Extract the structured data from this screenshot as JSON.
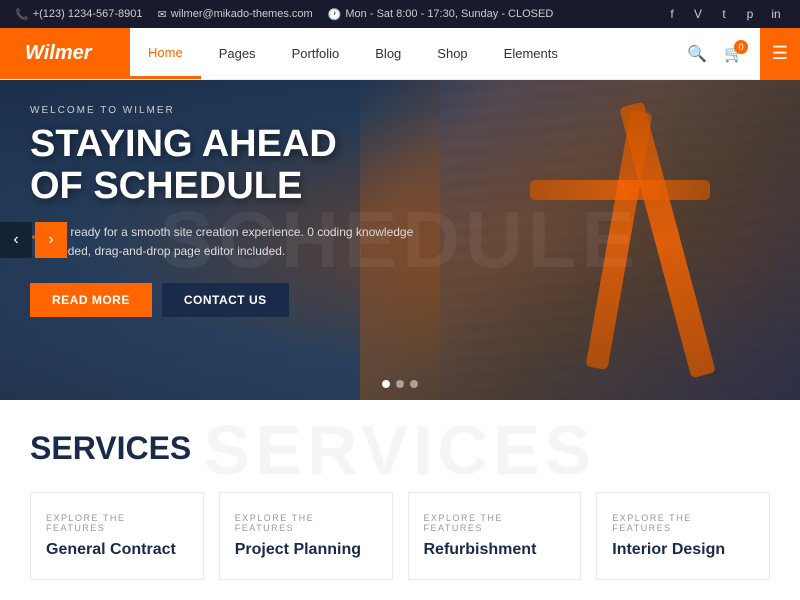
{
  "topbar": {
    "phone": "+(123) 1234-567-8901",
    "email": "wilmer@mikado-themes.com",
    "hours": "Mon - Sat 8:00 - 17:30, Sunday - CLOSED",
    "socials": [
      "f",
      "V",
      "t",
      "p",
      "in"
    ]
  },
  "navbar": {
    "logo": "Wilmer",
    "links": [
      {
        "label": "Home",
        "active": true
      },
      {
        "label": "Pages",
        "active": false
      },
      {
        "label": "Portfolio",
        "active": false
      },
      {
        "label": "Blog",
        "active": false
      },
      {
        "label": "Shop",
        "active": false
      },
      {
        "label": "Elements",
        "active": false
      }
    ],
    "cart_count": "0"
  },
  "hero": {
    "bg_text": "SCHEDULE",
    "welcome": "WELCOME TO WILMER",
    "title_line1": "STAYING AHEAD",
    "title_line2": "OF SCHEDULE",
    "subtitle": "Get ready for a smooth site creation experience. 0 coding knowledge needed, drag-and-drop page editor included.",
    "btn_primary": "Read More",
    "btn_secondary": "Contact Us",
    "dots": [
      {
        "active": true
      },
      {
        "active": false
      },
      {
        "active": false
      }
    ]
  },
  "services": {
    "bg_text": "SERVICES",
    "title": "SERVICES",
    "cards": [
      {
        "explore": "EXPLORE THE FEATURES",
        "name": "General Contract"
      },
      {
        "explore": "EXPLORE THE FEATURES",
        "name": "Project Planning"
      },
      {
        "explore": "EXPLORE THE FEATURES",
        "name": "Refurbishment"
      },
      {
        "explore": "EXPLORE THE FEATURES",
        "name": "Interior Design"
      }
    ]
  }
}
